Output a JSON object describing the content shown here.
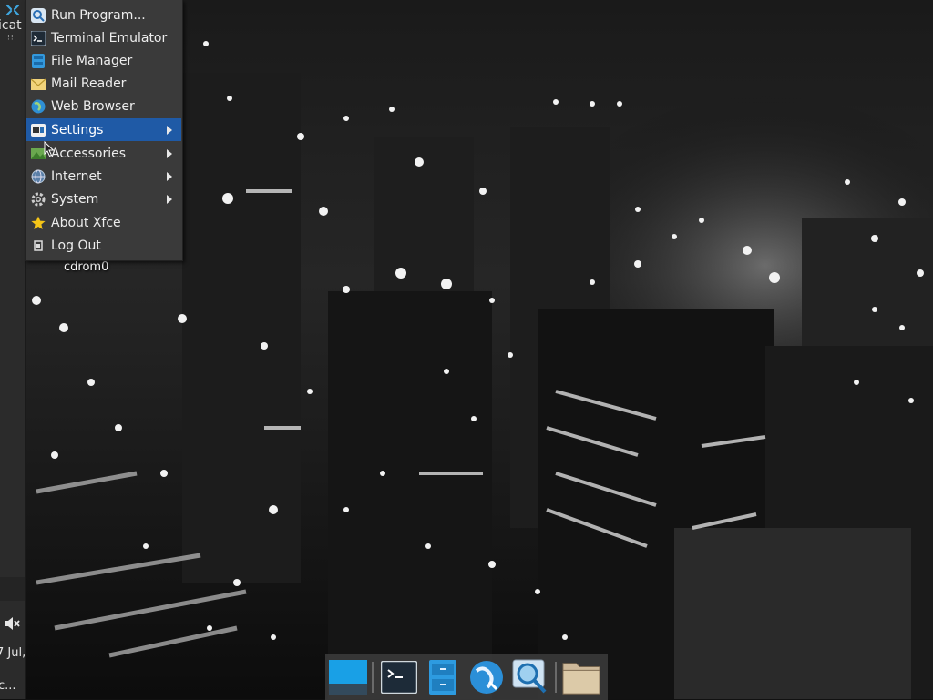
{
  "panel": {
    "apps_label": "icat",
    "clock_date": "7 Jul,",
    "clock_time": "c...",
    "volume_icon": "volume-muted-icon"
  },
  "menu": {
    "items": [
      {
        "label": "Run Program...",
        "icon": "search-icon",
        "submenu": false
      },
      {
        "label": "Terminal Emulator",
        "icon": "terminal-icon",
        "submenu": false
      },
      {
        "label": "File Manager",
        "icon": "file-manager-icon",
        "submenu": false
      },
      {
        "label": "Mail Reader",
        "icon": "mail-icon",
        "submenu": false
      },
      {
        "label": "Web Browser",
        "icon": "globe-icon",
        "submenu": false
      },
      {
        "label": "Settings",
        "icon": "settings-icon",
        "submenu": true,
        "active": true
      },
      {
        "label": "Accessories",
        "icon": "accessories-icon",
        "submenu": true
      },
      {
        "label": "Internet",
        "icon": "internet-icon",
        "submenu": true
      },
      {
        "label": "System",
        "icon": "gear-icon",
        "submenu": true
      },
      {
        "label": "About Xfce",
        "icon": "star-icon",
        "submenu": false
      },
      {
        "label": "Log Out",
        "icon": "logout-icon",
        "submenu": false
      }
    ]
  },
  "desktop": {
    "icons": [
      {
        "label": "cdrom0"
      }
    ]
  },
  "dock": {
    "items": [
      {
        "name": "show-desktop",
        "icon": "desktop-icon"
      },
      {
        "name": "terminal",
        "icon": "terminal-icon"
      },
      {
        "name": "file-manager",
        "icon": "file-manager-icon"
      },
      {
        "name": "web-browser",
        "icon": "globe-icon"
      },
      {
        "name": "app-finder",
        "icon": "search-icon"
      },
      {
        "name": "home-folder",
        "icon": "folder-icon"
      }
    ]
  },
  "colors": {
    "menu_bg": "#3a3a3a",
    "menu_highlight": "#1f5aa6",
    "panel_bg": "#2b2b2b"
  }
}
